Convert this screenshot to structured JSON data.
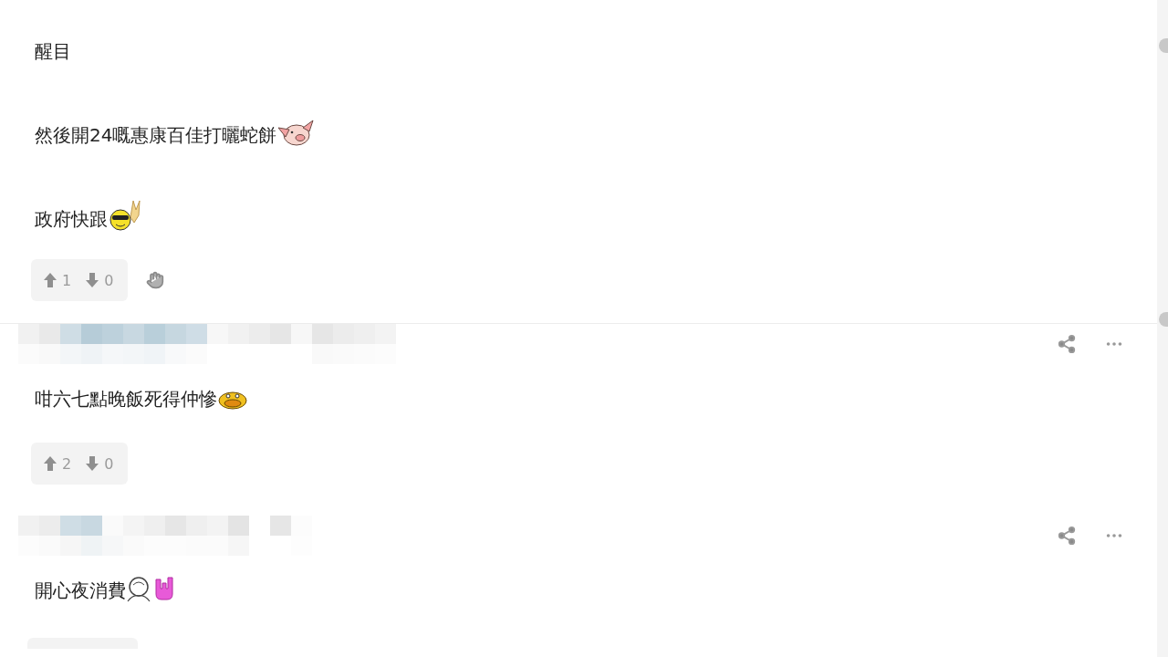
{
  "posts": [
    {
      "kind": "continued",
      "lines": [
        {
          "text": "醒目"
        },
        {
          "text": "然後開24嘅惠康百佳打曬蛇餅"
        },
        {
          "text": "政府快跟"
        }
      ],
      "votes": {
        "up": "1",
        "down": "0"
      },
      "report": true
    },
    {
      "kind": "full",
      "lines": [
        {
          "text": "咁六七點晚飯死得仲慘"
        }
      ],
      "votes": {
        "up": "2",
        "down": "0"
      },
      "report": false
    },
    {
      "kind": "full",
      "lines": [
        {
          "text": "開心夜消費"
        }
      ],
      "report": false
    }
  ]
}
